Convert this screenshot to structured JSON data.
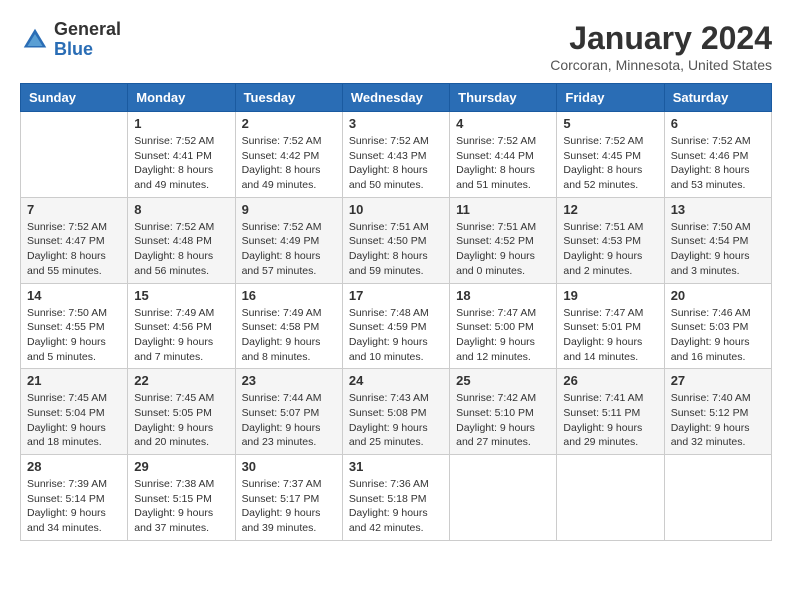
{
  "header": {
    "logo": {
      "general": "General",
      "blue": "Blue"
    },
    "title": "January 2024",
    "location": "Corcoran, Minnesota, United States"
  },
  "calendar": {
    "headers": [
      "Sunday",
      "Monday",
      "Tuesday",
      "Wednesday",
      "Thursday",
      "Friday",
      "Saturday"
    ],
    "weeks": [
      [
        {
          "day": "",
          "sunrise": "",
          "sunset": "",
          "daylight": ""
        },
        {
          "day": "1",
          "sunrise": "Sunrise: 7:52 AM",
          "sunset": "Sunset: 4:41 PM",
          "daylight": "Daylight: 8 hours and 49 minutes."
        },
        {
          "day": "2",
          "sunrise": "Sunrise: 7:52 AM",
          "sunset": "Sunset: 4:42 PM",
          "daylight": "Daylight: 8 hours and 49 minutes."
        },
        {
          "day": "3",
          "sunrise": "Sunrise: 7:52 AM",
          "sunset": "Sunset: 4:43 PM",
          "daylight": "Daylight: 8 hours and 50 minutes."
        },
        {
          "day": "4",
          "sunrise": "Sunrise: 7:52 AM",
          "sunset": "Sunset: 4:44 PM",
          "daylight": "Daylight: 8 hours and 51 minutes."
        },
        {
          "day": "5",
          "sunrise": "Sunrise: 7:52 AM",
          "sunset": "Sunset: 4:45 PM",
          "daylight": "Daylight: 8 hours and 52 minutes."
        },
        {
          "day": "6",
          "sunrise": "Sunrise: 7:52 AM",
          "sunset": "Sunset: 4:46 PM",
          "daylight": "Daylight: 8 hours and 53 minutes."
        }
      ],
      [
        {
          "day": "7",
          "sunrise": "Sunrise: 7:52 AM",
          "sunset": "Sunset: 4:47 PM",
          "daylight": "Daylight: 8 hours and 55 minutes."
        },
        {
          "day": "8",
          "sunrise": "Sunrise: 7:52 AM",
          "sunset": "Sunset: 4:48 PM",
          "daylight": "Daylight: 8 hours and 56 minutes."
        },
        {
          "day": "9",
          "sunrise": "Sunrise: 7:52 AM",
          "sunset": "Sunset: 4:49 PM",
          "daylight": "Daylight: 8 hours and 57 minutes."
        },
        {
          "day": "10",
          "sunrise": "Sunrise: 7:51 AM",
          "sunset": "Sunset: 4:50 PM",
          "daylight": "Daylight: 8 hours and 59 minutes."
        },
        {
          "day": "11",
          "sunrise": "Sunrise: 7:51 AM",
          "sunset": "Sunset: 4:52 PM",
          "daylight": "Daylight: 9 hours and 0 minutes."
        },
        {
          "day": "12",
          "sunrise": "Sunrise: 7:51 AM",
          "sunset": "Sunset: 4:53 PM",
          "daylight": "Daylight: 9 hours and 2 minutes."
        },
        {
          "day": "13",
          "sunrise": "Sunrise: 7:50 AM",
          "sunset": "Sunset: 4:54 PM",
          "daylight": "Daylight: 9 hours and 3 minutes."
        }
      ],
      [
        {
          "day": "14",
          "sunrise": "Sunrise: 7:50 AM",
          "sunset": "Sunset: 4:55 PM",
          "daylight": "Daylight: 9 hours and 5 minutes."
        },
        {
          "day": "15",
          "sunrise": "Sunrise: 7:49 AM",
          "sunset": "Sunset: 4:56 PM",
          "daylight": "Daylight: 9 hours and 7 minutes."
        },
        {
          "day": "16",
          "sunrise": "Sunrise: 7:49 AM",
          "sunset": "Sunset: 4:58 PM",
          "daylight": "Daylight: 9 hours and 8 minutes."
        },
        {
          "day": "17",
          "sunrise": "Sunrise: 7:48 AM",
          "sunset": "Sunset: 4:59 PM",
          "daylight": "Daylight: 9 hours and 10 minutes."
        },
        {
          "day": "18",
          "sunrise": "Sunrise: 7:47 AM",
          "sunset": "Sunset: 5:00 PM",
          "daylight": "Daylight: 9 hours and 12 minutes."
        },
        {
          "day": "19",
          "sunrise": "Sunrise: 7:47 AM",
          "sunset": "Sunset: 5:01 PM",
          "daylight": "Daylight: 9 hours and 14 minutes."
        },
        {
          "day": "20",
          "sunrise": "Sunrise: 7:46 AM",
          "sunset": "Sunset: 5:03 PM",
          "daylight": "Daylight: 9 hours and 16 minutes."
        }
      ],
      [
        {
          "day": "21",
          "sunrise": "Sunrise: 7:45 AM",
          "sunset": "Sunset: 5:04 PM",
          "daylight": "Daylight: 9 hours and 18 minutes."
        },
        {
          "day": "22",
          "sunrise": "Sunrise: 7:45 AM",
          "sunset": "Sunset: 5:05 PM",
          "daylight": "Daylight: 9 hours and 20 minutes."
        },
        {
          "day": "23",
          "sunrise": "Sunrise: 7:44 AM",
          "sunset": "Sunset: 5:07 PM",
          "daylight": "Daylight: 9 hours and 23 minutes."
        },
        {
          "day": "24",
          "sunrise": "Sunrise: 7:43 AM",
          "sunset": "Sunset: 5:08 PM",
          "daylight": "Daylight: 9 hours and 25 minutes."
        },
        {
          "day": "25",
          "sunrise": "Sunrise: 7:42 AM",
          "sunset": "Sunset: 5:10 PM",
          "daylight": "Daylight: 9 hours and 27 minutes."
        },
        {
          "day": "26",
          "sunrise": "Sunrise: 7:41 AM",
          "sunset": "Sunset: 5:11 PM",
          "daylight": "Daylight: 9 hours and 29 minutes."
        },
        {
          "day": "27",
          "sunrise": "Sunrise: 7:40 AM",
          "sunset": "Sunset: 5:12 PM",
          "daylight": "Daylight: 9 hours and 32 minutes."
        }
      ],
      [
        {
          "day": "28",
          "sunrise": "Sunrise: 7:39 AM",
          "sunset": "Sunset: 5:14 PM",
          "daylight": "Daylight: 9 hours and 34 minutes."
        },
        {
          "day": "29",
          "sunrise": "Sunrise: 7:38 AM",
          "sunset": "Sunset: 5:15 PM",
          "daylight": "Daylight: 9 hours and 37 minutes."
        },
        {
          "day": "30",
          "sunrise": "Sunrise: 7:37 AM",
          "sunset": "Sunset: 5:17 PM",
          "daylight": "Daylight: 9 hours and 39 minutes."
        },
        {
          "day": "31",
          "sunrise": "Sunrise: 7:36 AM",
          "sunset": "Sunset: 5:18 PM",
          "daylight": "Daylight: 9 hours and 42 minutes."
        },
        {
          "day": "",
          "sunrise": "",
          "sunset": "",
          "daylight": ""
        },
        {
          "day": "",
          "sunrise": "",
          "sunset": "",
          "daylight": ""
        },
        {
          "day": "",
          "sunrise": "",
          "sunset": "",
          "daylight": ""
        }
      ]
    ]
  }
}
